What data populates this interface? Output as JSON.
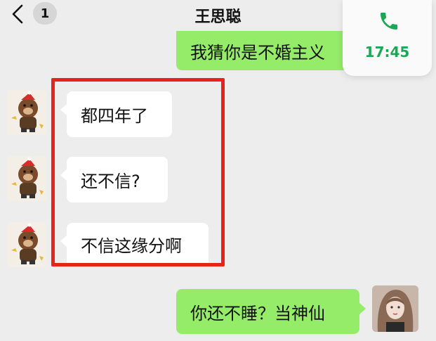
{
  "header": {
    "back_icon": "chevron-left-icon",
    "unread_count": "1",
    "title": "王思聪"
  },
  "call": {
    "icon": "phone-icon",
    "duration": "17:45",
    "color": "#19a854"
  },
  "messages": [
    {
      "sender": "self",
      "text": "我猜你是不婚主义"
    },
    {
      "sender": "other",
      "text": "都四年了"
    },
    {
      "sender": "other",
      "text": "还不信?"
    },
    {
      "sender": "other",
      "text": "不信这缘分啊"
    },
    {
      "sender": "self",
      "text": "你还不睡？当神仙"
    }
  ],
  "colors": {
    "background": "#ededed",
    "incoming_bubble": "#ffffff",
    "outgoing_bubble": "#95ec69",
    "highlight_box": "#e8231b"
  }
}
